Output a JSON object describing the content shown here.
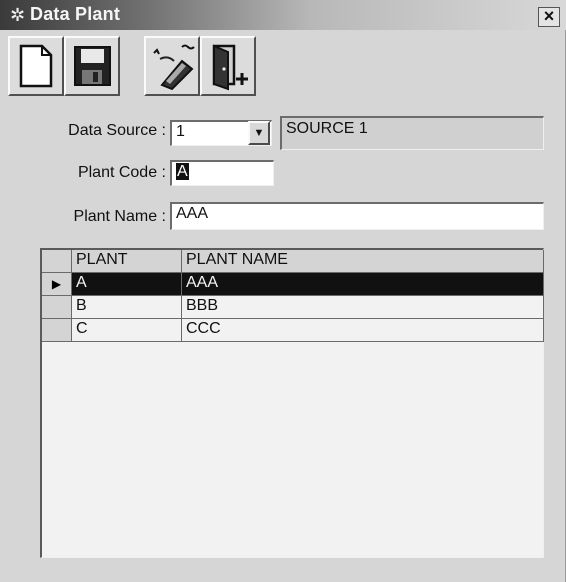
{
  "window": {
    "title": "Data Plant",
    "icon": "gear-icon",
    "close_label": "×"
  },
  "toolbar": {
    "buttons": [
      {
        "name": "new-button",
        "icon": "new-document-icon"
      },
      {
        "name": "save-button",
        "icon": "floppy-disk-icon"
      },
      {
        "name": "clear-button",
        "icon": "eraser-icon"
      },
      {
        "name": "exit-button",
        "icon": "exit-door-icon"
      }
    ]
  },
  "form": {
    "data_source_label": "Data Source :",
    "data_source_value": "1",
    "source_name": "SOURCE 1",
    "plant_code_label": "Plant Code :",
    "plant_code_value": "A",
    "plant_name_label": "Plant Name :",
    "plant_name_value": "AAA"
  },
  "grid": {
    "columns": [
      "PLANT",
      "PLANT NAME"
    ],
    "rows": [
      {
        "plant": "A",
        "plant_name": "AAA"
      },
      {
        "plant": "B",
        "plant_name": "BBB"
      },
      {
        "plant": "C",
        "plant_name": "CCC"
      }
    ],
    "selected_indicator": "▶"
  }
}
